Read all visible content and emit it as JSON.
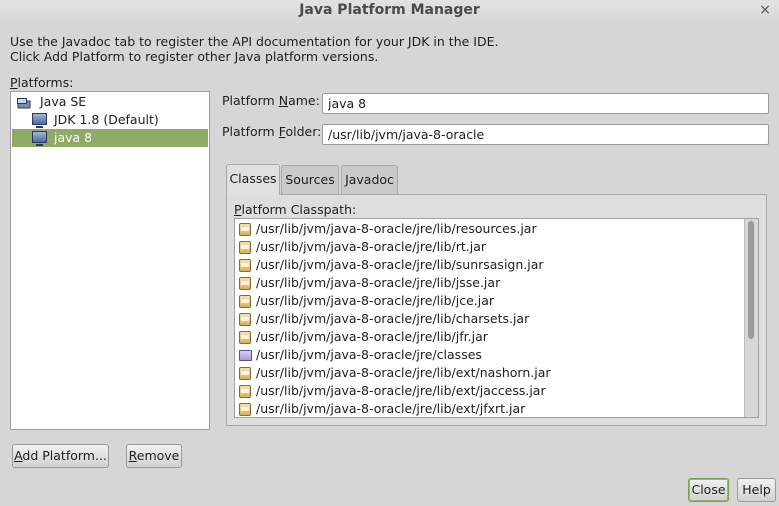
{
  "window": {
    "title": "Java Platform Manager",
    "close_glyph": "×"
  },
  "intro": {
    "line1": "Use the Javadoc tab to register the API documentation for your JDK in the IDE.",
    "line2": "Click Add Platform to register other Java platform versions."
  },
  "platforms": {
    "label_u": "P",
    "label_rest": "latforms:",
    "tree": [
      {
        "label": "Java SE",
        "icon": "java-se-category-icon",
        "selected": false
      },
      {
        "label": "JDK 1.8 (Default)",
        "icon": "platform-monitor-icon",
        "selected": false
      },
      {
        "label": "java 8",
        "icon": "platform-monitor-icon",
        "selected": true
      }
    ]
  },
  "fields": {
    "name_label_pre": "Platform ",
    "name_label_u": "N",
    "name_label_post": "ame:",
    "name_value": "java 8",
    "folder_label_pre": "Platform ",
    "folder_label_u": "F",
    "folder_label_post": "older:",
    "folder_value": "/usr/lib/jvm/java-8-oracle"
  },
  "tabs": [
    {
      "label": "Classes",
      "active": true
    },
    {
      "label": "Sources",
      "active": false
    },
    {
      "label": "Javadoc",
      "active": false
    }
  ],
  "classpath": {
    "label_u": "P",
    "label_rest": "latform Classpath:",
    "items": [
      {
        "path": "/usr/lib/jvm/java-8-oracle/jre/lib/resources.jar",
        "icon": "jar-icon"
      },
      {
        "path": "/usr/lib/jvm/java-8-oracle/jre/lib/rt.jar",
        "icon": "jar-icon"
      },
      {
        "path": "/usr/lib/jvm/java-8-oracle/jre/lib/sunrsasign.jar",
        "icon": "jar-icon"
      },
      {
        "path": "/usr/lib/jvm/java-8-oracle/jre/lib/jsse.jar",
        "icon": "jar-icon"
      },
      {
        "path": "/usr/lib/jvm/java-8-oracle/jre/lib/jce.jar",
        "icon": "jar-icon"
      },
      {
        "path": "/usr/lib/jvm/java-8-oracle/jre/lib/charsets.jar",
        "icon": "jar-icon"
      },
      {
        "path": "/usr/lib/jvm/java-8-oracle/jre/lib/jfr.jar",
        "icon": "jar-icon"
      },
      {
        "path": "/usr/lib/jvm/java-8-oracle/jre/classes",
        "icon": "folder-icon"
      },
      {
        "path": "/usr/lib/jvm/java-8-oracle/jre/lib/ext/nashorn.jar",
        "icon": "jar-icon"
      },
      {
        "path": "/usr/lib/jvm/java-8-oracle/jre/lib/ext/jaccess.jar",
        "icon": "jar-icon"
      },
      {
        "path": "/usr/lib/jvm/java-8-oracle/jre/lib/ext/jfxrt.jar",
        "icon": "jar-icon"
      }
    ]
  },
  "buttons": {
    "add_platform_u": "A",
    "add_platform_rest": "dd Platform...",
    "remove_u": "R",
    "remove_rest": "emove",
    "close": "Close",
    "help": "Help"
  },
  "colors": {
    "selection": "#8faa67",
    "window_bg": "#d6d6d6"
  }
}
